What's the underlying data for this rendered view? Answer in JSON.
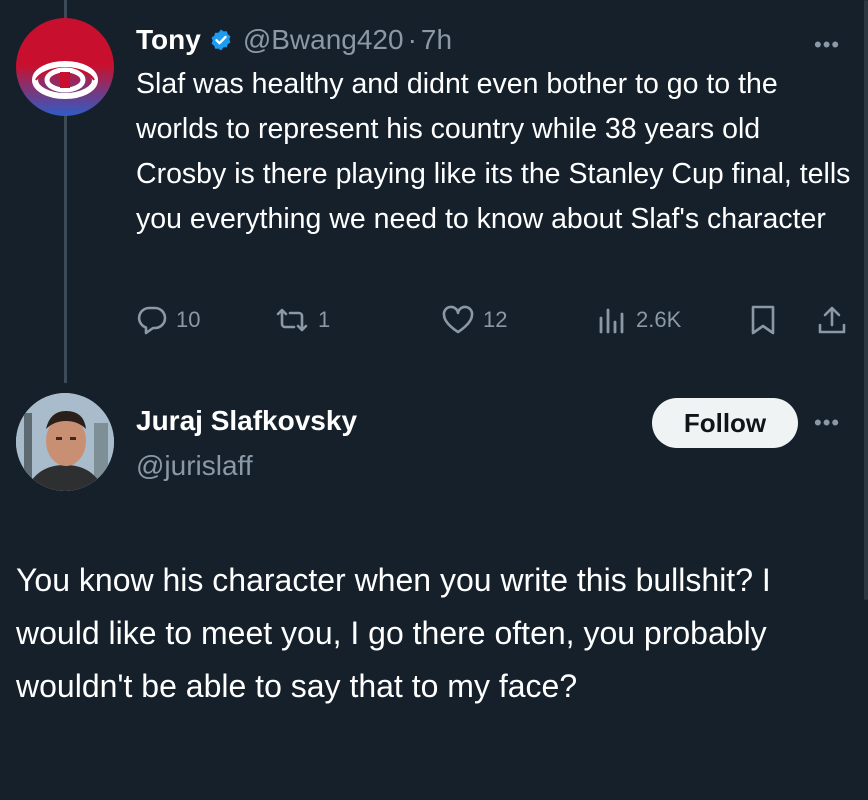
{
  "tweet1": {
    "author_name": "Tony",
    "verified_icon": "verified-badge-icon",
    "handle": "@Bwang420",
    "separator": "·",
    "time": "7h",
    "text": "Slaf was healthy and didnt even bother to go to the worlds to represent his country while 38 years old Crosby is there playing like its the Stanley Cup final, tells you everything we need to know about Slaf's character",
    "more_label": "•••",
    "actions": {
      "replies": "10",
      "reposts": "1",
      "likes": "12",
      "views": "2.6K"
    }
  },
  "tweet2": {
    "author_name": "Juraj Slafkovsky",
    "handle": "@jurislaff",
    "follow_label": "Follow",
    "more_label": "•••",
    "text": "You know his character when you write this bullshit? I would like to meet you, I go there often, you probably wouldn't be able to say that to my face?"
  },
  "colors": {
    "background": "#15202b",
    "text_primary": "#ffffff",
    "text_secondary": "#8b98a5",
    "verified": "#1d9bf0",
    "follow_bg": "#eff3f4"
  }
}
